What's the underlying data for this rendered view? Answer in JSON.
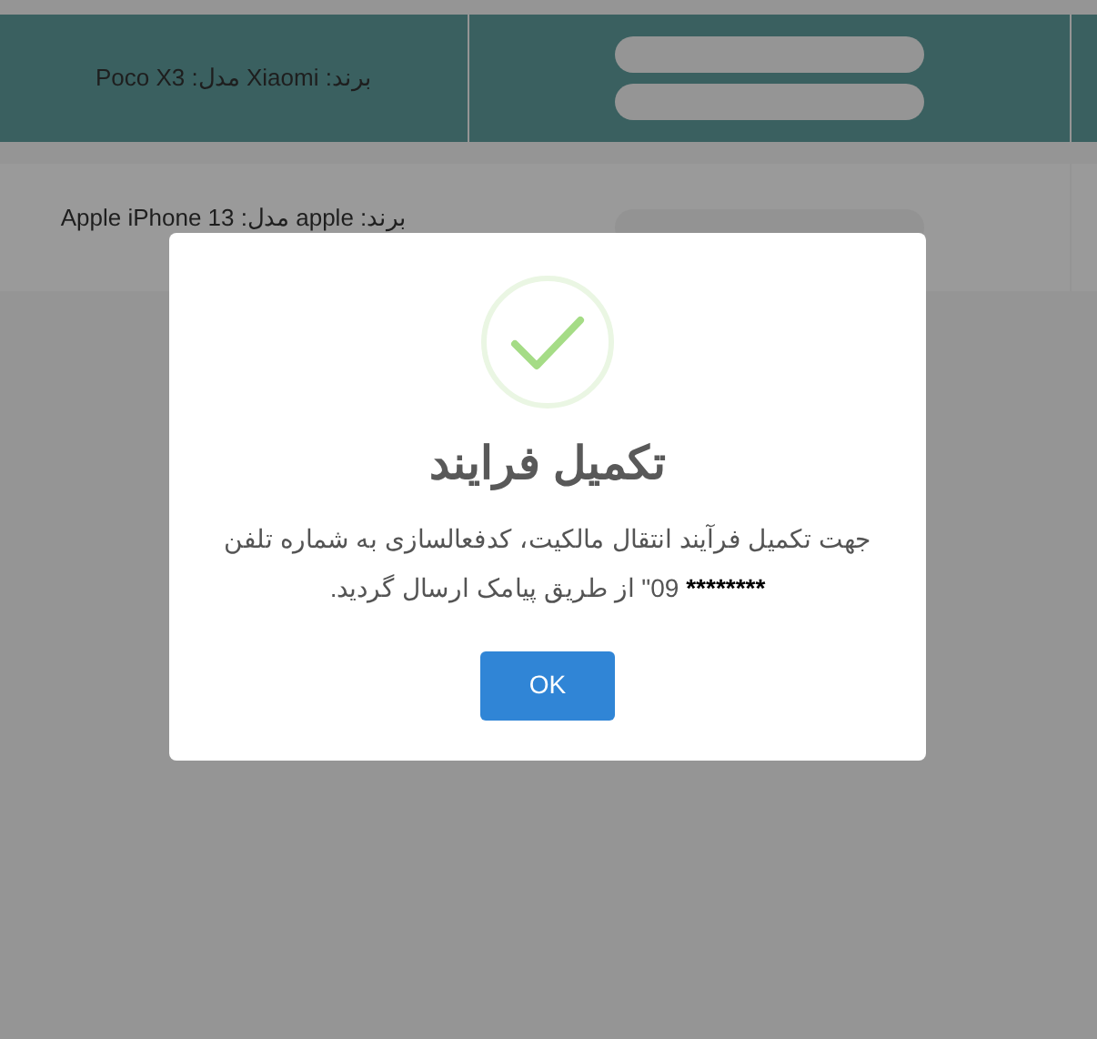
{
  "table": {
    "rows": [
      {
        "device": "برند: Xiaomi مدل: Poco X3",
        "selected": true
      },
      {
        "device": "برند: apple مدل: Apple iPhone 13",
        "selected": false
      }
    ]
  },
  "dialog": {
    "title": "تکمیل فرایند",
    "message": {
      "before": "جهت تکمیل فرآیند انتقال مالکیت، کدفعالسازی به شماره تلفن",
      "phone": "********",
      "after": "09\" از طریق پیامک ارسال گردید."
    },
    "button": "OK"
  }
}
